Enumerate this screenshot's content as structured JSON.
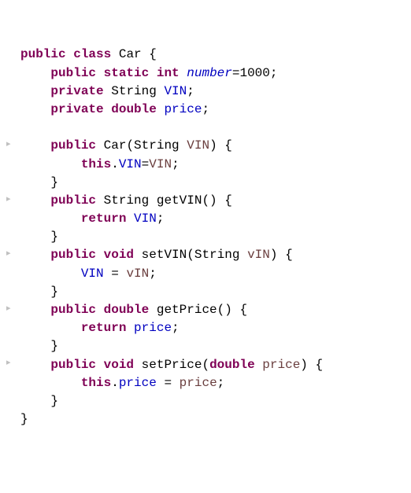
{
  "code": {
    "l1": {
      "kw1": "public",
      "kw2": "class",
      "type": "Car",
      "brace": " {"
    },
    "l2": {
      "kw1": "public",
      "kw2": "static",
      "kw3": "int",
      "field": "number",
      "rest": "=1000;"
    },
    "l3": {
      "kw1": "private",
      "type": "String",
      "field": "VIN",
      "semi": ";"
    },
    "l4": {
      "kw1": "private",
      "kw2": "double",
      "field": "price",
      "semi": ";"
    },
    "l5": {
      "blank": ""
    },
    "l6": {
      "kw1": "public",
      "type": "Car",
      "open": "(String ",
      "param": "VIN",
      "close": ") {"
    },
    "l7": {
      "kw1": "this",
      "dot": ".",
      "field": "VIN",
      "eq": "=",
      "param": "VIN",
      "semi": ";"
    },
    "l8": {
      "brace": "}"
    },
    "l9": {
      "kw1": "public",
      "type": "String",
      "method": "getVIN",
      "paren": "() {"
    },
    "l10": {
      "kw1": "return",
      "field": "VIN",
      "semi": ";"
    },
    "l11": {
      "brace": "}"
    },
    "l12": {
      "kw1": "public",
      "kw2": "void",
      "method": "setVIN",
      "open": "(String ",
      "param": "vIN",
      "close": ") {"
    },
    "l13": {
      "field": "VIN",
      "eq": " = ",
      "param": "vIN",
      "semi": ";"
    },
    "l14": {
      "brace": "}"
    },
    "l15": {
      "kw1": "public",
      "kw2": "double",
      "method": "getPrice",
      "paren": "() {"
    },
    "l16": {
      "kw1": "return",
      "field": "price",
      "semi": ";"
    },
    "l17": {
      "brace": "}"
    },
    "l18": {
      "kw1": "public",
      "kw2": "void",
      "method": "setPrice",
      "open": "(",
      "kw3": "double",
      "param": "price",
      "close": ") {"
    },
    "l19": {
      "kw1": "this",
      "dot": ".",
      "field": "price",
      "eq": " = ",
      "param": "price",
      "semi": ";"
    },
    "l20": {
      "brace": "}"
    },
    "l21": {
      "brace": "}"
    }
  },
  "gutter": {
    "fold": "▸"
  }
}
